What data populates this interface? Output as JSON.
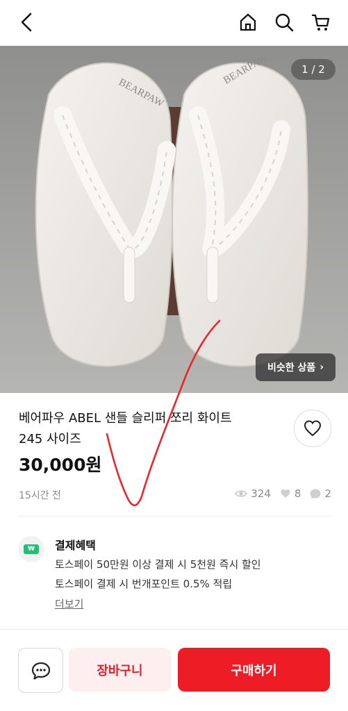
{
  "header": {
    "back_icon": "back-arrow-icon",
    "home_icon": "home-icon",
    "search_icon": "search-icon",
    "cart_icon": "cart-icon"
  },
  "gallery": {
    "counter": "1 / 2",
    "similar_button": "비슷한 상품",
    "similar_arrow": "›",
    "brand_mark": "BEARPAW"
  },
  "product": {
    "title_line1": "베어파우 ABEL 샌들 슬리퍼 쪼리 화이트",
    "title_line2": "245 사이즈",
    "price": "30,000원",
    "posted": "15시간 전",
    "views": "324",
    "likes": "8",
    "chats": "2"
  },
  "benefits": {
    "icon_text": "₩",
    "title": "결제혜택",
    "line1": "토스페이 50만원 이상 결제 시 5천원 즉시 할인",
    "line2": "토스페이 결제 시 번개포인트 0.5% 적립",
    "more": "더보기"
  },
  "actions": {
    "cart": "장바구니",
    "buy": "구매하기"
  },
  "colors": {
    "accent": "#ee1c25",
    "accent_soft": "#fdeff0",
    "muted": "#8a8a8a"
  }
}
